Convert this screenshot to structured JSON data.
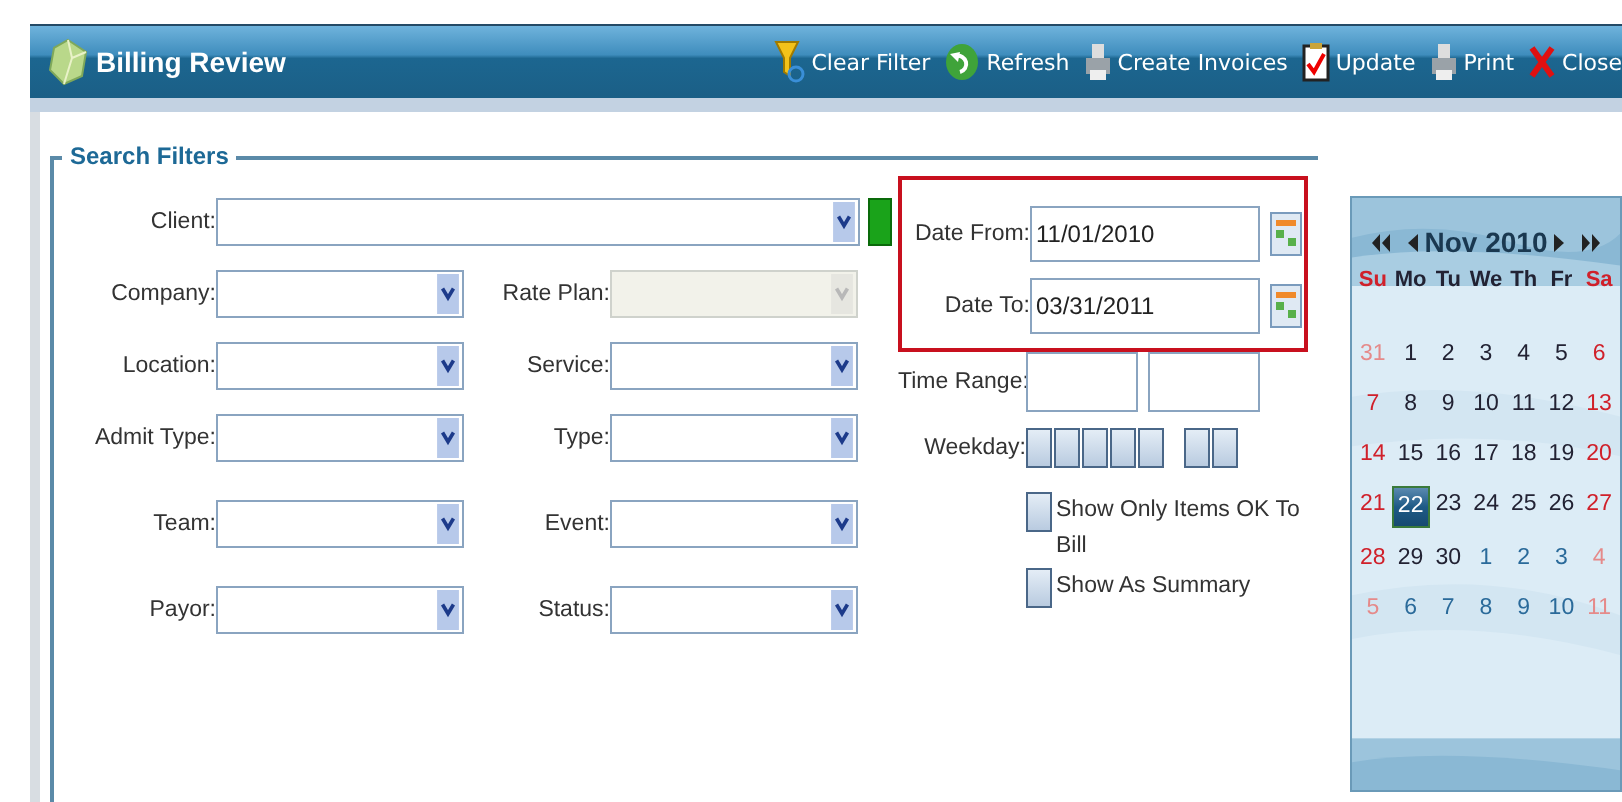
{
  "header": {
    "title": "Billing Review",
    "actions": [
      {
        "label": "Clear Filter",
        "kind": "funnel"
      },
      {
        "label": "Refresh",
        "kind": "refresh"
      },
      {
        "label": "Create Invoices",
        "kind": "invoice"
      },
      {
        "label": "Update",
        "kind": "clipboard"
      },
      {
        "label": "Print",
        "kind": "printer"
      },
      {
        "label": "Close",
        "kind": "close"
      }
    ]
  },
  "filters": {
    "legend": "Search Filters",
    "client": {
      "label": "Client:"
    },
    "rows": [
      {
        "left": {
          "label": "Company:",
          "disabled": false
        },
        "right": {
          "label": "Rate Plan:",
          "disabled": true
        }
      },
      {
        "left": {
          "label": "Location:",
          "disabled": false
        },
        "right": {
          "label": "Service:",
          "disabled": false
        }
      },
      {
        "left": {
          "label": "Admit Type:",
          "disabled": false
        },
        "right": {
          "label": "Type:",
          "disabled": false
        }
      },
      {
        "left": {
          "label": "Team:",
          "disabled": false
        },
        "right": {
          "label": "Event:",
          "disabled": false
        }
      },
      {
        "left": {
          "label": "Payor:",
          "disabled": false
        },
        "right": {
          "label": "Status:",
          "disabled": false
        }
      }
    ],
    "date_from": {
      "label": "Date From:",
      "value": "11/01/2010"
    },
    "date_to": {
      "label": "Date To:",
      "value": "03/31/2011"
    },
    "time_range": {
      "label": "Time Range:"
    },
    "weekday": {
      "label": "Weekday:",
      "boxes": [
        {
          "checked": false
        },
        {
          "checked": false
        },
        {
          "checked": false
        },
        {
          "checked": false
        },
        {
          "checked": false
        },
        {
          "checked": false
        },
        {
          "checked": false
        }
      ]
    },
    "options": [
      {
        "label": "Show Only Items OK To Bill",
        "checked": false
      },
      {
        "label": "Show As Summary",
        "checked": false
      }
    ]
  },
  "calendar": {
    "month": "Nov 2010",
    "weekdays": [
      {
        "label": "Su",
        "weekend": true
      },
      {
        "label": "Mo",
        "weekend": false
      },
      {
        "label": "Tu",
        "weekend": false
      },
      {
        "label": "We",
        "weekend": false
      },
      {
        "label": "Th",
        "weekend": false
      },
      {
        "label": "Fr",
        "weekend": false
      },
      {
        "label": "Sa",
        "weekend": true
      }
    ],
    "weeks": [
      [
        {
          "day": "31",
          "other_month": true,
          "weekend": true,
          "selected": false
        },
        {
          "day": "1",
          "other_month": false,
          "weekend": false,
          "selected": false
        },
        {
          "day": "2",
          "other_month": false,
          "weekend": false,
          "selected": false
        },
        {
          "day": "3",
          "other_month": false,
          "weekend": false,
          "selected": false
        },
        {
          "day": "4",
          "other_month": false,
          "weekend": false,
          "selected": false
        },
        {
          "day": "5",
          "other_month": false,
          "weekend": false,
          "selected": false
        },
        {
          "day": "6",
          "other_month": false,
          "weekend": true,
          "selected": false
        }
      ],
      [
        {
          "day": "7",
          "other_month": false,
          "weekend": true,
          "selected": false
        },
        {
          "day": "8",
          "other_month": false,
          "weekend": false,
          "selected": false
        },
        {
          "day": "9",
          "other_month": false,
          "weekend": false,
          "selected": false
        },
        {
          "day": "10",
          "other_month": false,
          "weekend": false,
          "selected": false
        },
        {
          "day": "11",
          "other_month": false,
          "weekend": false,
          "selected": false
        },
        {
          "day": "12",
          "other_month": false,
          "weekend": false,
          "selected": false
        },
        {
          "day": "13",
          "other_month": false,
          "weekend": true,
          "selected": false
        }
      ],
      [
        {
          "day": "14",
          "other_month": false,
          "weekend": true,
          "selected": false
        },
        {
          "day": "15",
          "other_month": false,
          "weekend": false,
          "selected": false
        },
        {
          "day": "16",
          "other_month": false,
          "weekend": false,
          "selected": false
        },
        {
          "day": "17",
          "other_month": false,
          "weekend": false,
          "selected": false
        },
        {
          "day": "18",
          "other_month": false,
          "weekend": false,
          "selected": false
        },
        {
          "day": "19",
          "other_month": false,
          "weekend": false,
          "selected": false
        },
        {
          "day": "20",
          "other_month": false,
          "weekend": true,
          "selected": false
        }
      ],
      [
        {
          "day": "21",
          "other_month": false,
          "weekend": true,
          "selected": false
        },
        {
          "day": "22",
          "other_month": false,
          "weekend": false,
          "selected": true
        },
        {
          "day": "23",
          "other_month": false,
          "weekend": false,
          "selected": false
        },
        {
          "day": "24",
          "other_month": false,
          "weekend": false,
          "selected": false
        },
        {
          "day": "25",
          "other_month": false,
          "weekend": false,
          "selected": false
        },
        {
          "day": "26",
          "other_month": false,
          "weekend": false,
          "selected": false
        },
        {
          "day": "27",
          "other_month": false,
          "weekend": true,
          "selected": false
        }
      ],
      [
        {
          "day": "28",
          "other_month": false,
          "weekend": true,
          "selected": false
        },
        {
          "day": "29",
          "other_month": false,
          "weekend": false,
          "selected": false
        },
        {
          "day": "30",
          "other_month": false,
          "weekend": false,
          "selected": false
        },
        {
          "day": "1",
          "other_month": true,
          "weekend": false,
          "selected": false
        },
        {
          "day": "2",
          "other_month": true,
          "weekend": false,
          "selected": false
        },
        {
          "day": "3",
          "other_month": true,
          "weekend": false,
          "selected": false
        },
        {
          "day": "4",
          "other_month": true,
          "weekend": true,
          "selected": false
        }
      ],
      [
        {
          "day": "5",
          "other_month": true,
          "weekend": true,
          "selected": false
        },
        {
          "day": "6",
          "other_month": true,
          "weekend": false,
          "selected": false
        },
        {
          "day": "7",
          "other_month": true,
          "weekend": false,
          "selected": false
        },
        {
          "day": "8",
          "other_month": true,
          "weekend": false,
          "selected": false
        },
        {
          "day": "9",
          "other_month": true,
          "weekend": false,
          "selected": false
        },
        {
          "day": "10",
          "other_month": true,
          "weekend": false,
          "selected": false
        },
        {
          "day": "11",
          "other_month": true,
          "weekend": true,
          "selected": false
        }
      ]
    ]
  }
}
